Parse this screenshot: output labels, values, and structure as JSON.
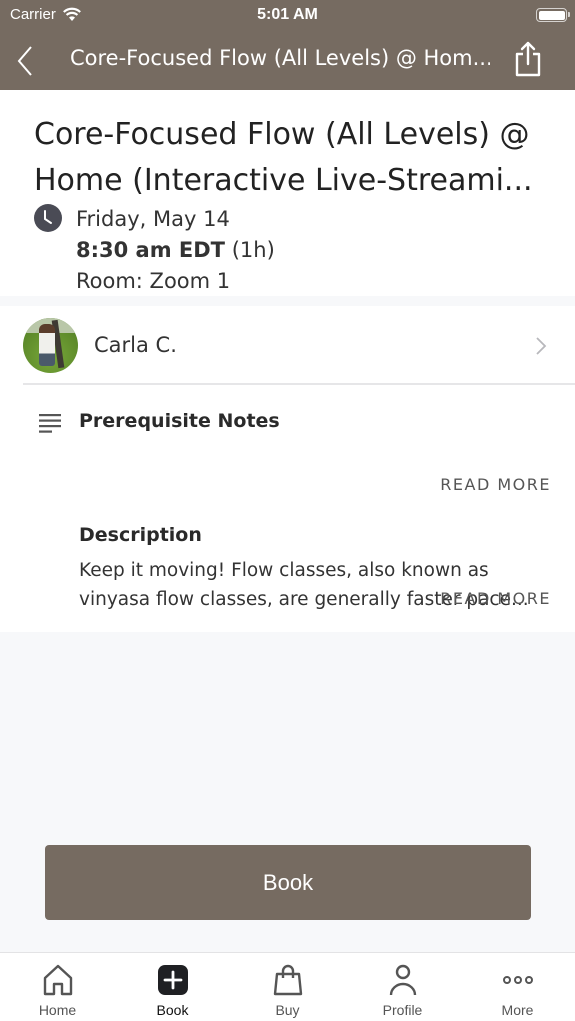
{
  "status_bar": {
    "carrier": "Carrier",
    "time": "5:01 AM",
    "battery_level": 1.0
  },
  "nav": {
    "title": "Core-Focused Flow (All Levels) @ Hom...",
    "back_icon": "chevron-left-icon",
    "share_icon": "share-icon"
  },
  "class": {
    "title": "Core-Focused Flow (All Levels) @ Home (Interactive Live-Streami...",
    "date": "Friday, May 14",
    "time": "8:30 am EDT",
    "duration": "(1h)",
    "room": "Room: Zoom 1"
  },
  "instructor": {
    "name": "Carla C."
  },
  "prerequisite": {
    "title": "Prerequisite Notes",
    "read_more": "READ MORE"
  },
  "description": {
    "title": "Description",
    "text": "Keep it moving! Flow classes, also known as vinyasa flow classes, are generally faster pace...",
    "read_more": "READ MORE"
  },
  "book_button": {
    "label": "Book"
  },
  "tabbar": {
    "items": [
      {
        "label": "Home",
        "icon": "home-icon",
        "active": false
      },
      {
        "label": "Book",
        "icon": "plus-square-icon",
        "active": true
      },
      {
        "label": "Buy",
        "icon": "shopping-bag-icon",
        "active": false
      },
      {
        "label": "Profile",
        "icon": "person-icon",
        "active": false
      },
      {
        "label": "More",
        "icon": "more-icon",
        "active": false
      }
    ]
  },
  "colors": {
    "brand": "#766b61",
    "background": "#f7f8fa",
    "icon_dark": "#4a4b55"
  }
}
